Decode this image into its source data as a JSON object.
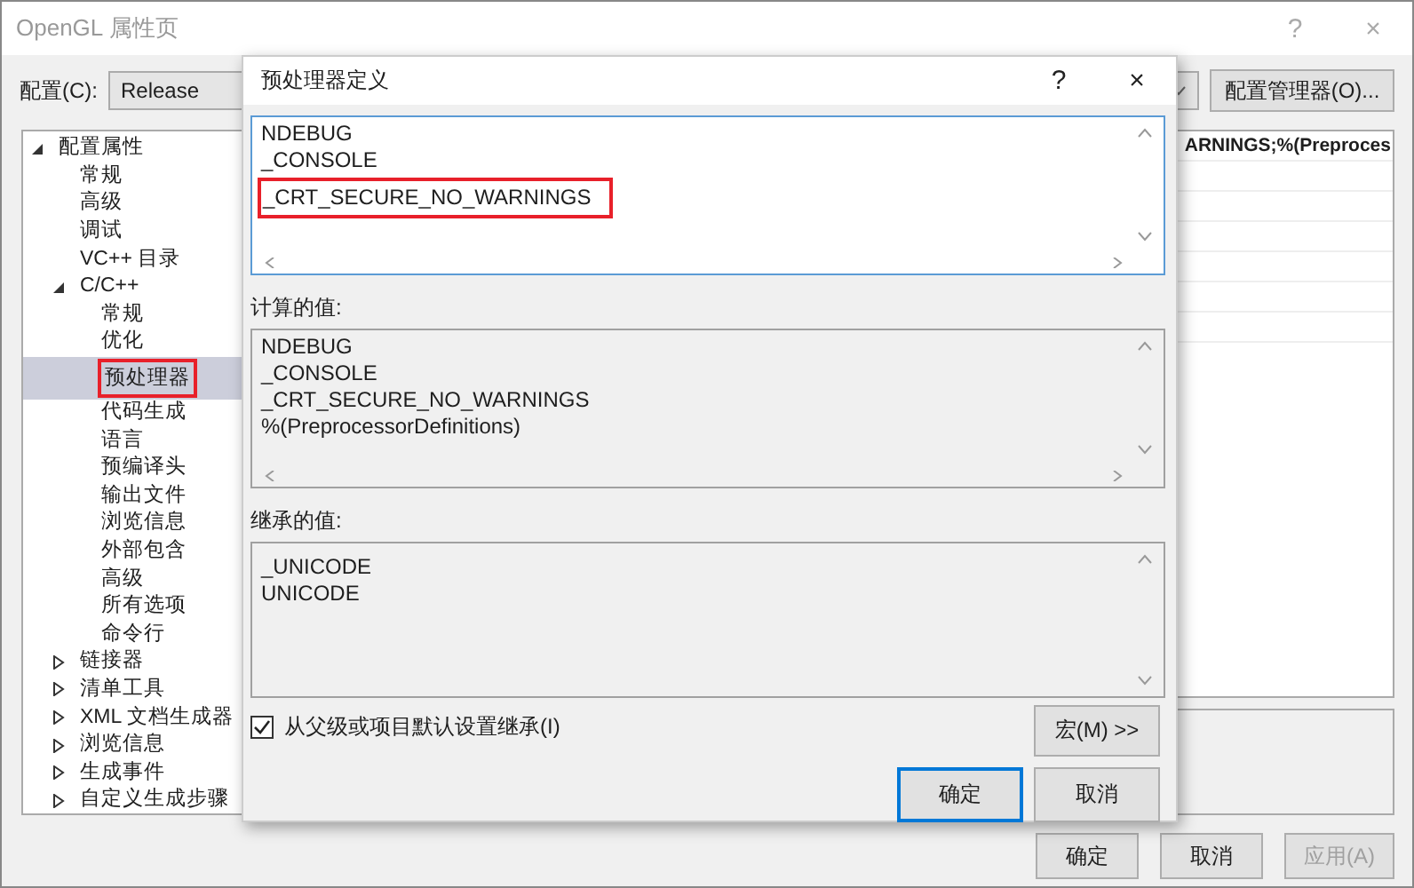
{
  "window": {
    "title": "OpenGL 属性页",
    "help": "?",
    "close": "×"
  },
  "config": {
    "label": "配置(C):",
    "value": "Release",
    "manager_button": "配置管理器(O)..."
  },
  "tree": [
    {
      "label": "配置属性",
      "expanded": true,
      "selected": false,
      "highlighted": false,
      "children": [
        {
          "label": "常规",
          "selected": false,
          "highlighted": false
        },
        {
          "label": "高级",
          "selected": false,
          "highlighted": false
        },
        {
          "label": "调试",
          "selected": false,
          "highlighted": false
        },
        {
          "label": "VC++ 目录",
          "selected": false,
          "highlighted": false
        },
        {
          "label": "C/C++",
          "expanded": true,
          "selected": false,
          "highlighted": false,
          "children": [
            {
              "label": "常规",
              "selected": false,
              "highlighted": false
            },
            {
              "label": "优化",
              "selected": false,
              "highlighted": false
            },
            {
              "label": "预处理器",
              "selected": true,
              "highlighted": true
            },
            {
              "label": "代码生成",
              "selected": false,
              "highlighted": false
            },
            {
              "label": "语言",
              "selected": false,
              "highlighted": false
            },
            {
              "label": "预编译头",
              "selected": false,
              "highlighted": false
            },
            {
              "label": "输出文件",
              "selected": false,
              "highlighted": false
            },
            {
              "label": "浏览信息",
              "selected": false,
              "highlighted": false
            },
            {
              "label": "外部包含",
              "selected": false,
              "highlighted": false
            },
            {
              "label": "高级",
              "selected": false,
              "highlighted": false
            },
            {
              "label": "所有选项",
              "selected": false,
              "highlighted": false
            },
            {
              "label": "命令行",
              "selected": false,
              "highlighted": false
            }
          ]
        },
        {
          "label": "链接器",
          "expanded": false,
          "selected": false,
          "highlighted": false
        },
        {
          "label": "清单工具",
          "expanded": false,
          "selected": false,
          "highlighted": false
        },
        {
          "label": "XML 文档生成器",
          "expanded": false,
          "selected": false,
          "highlighted": false
        },
        {
          "label": "浏览信息",
          "expanded": false,
          "selected": false,
          "highlighted": false
        },
        {
          "label": "生成事件",
          "expanded": false,
          "selected": false,
          "highlighted": false
        },
        {
          "label": "自定义生成步骤",
          "expanded": false,
          "selected": false,
          "highlighted": false
        }
      ]
    }
  ],
  "property_value": "ARNINGS;%(Preproces",
  "buttons": [
    {
      "label": "确定",
      "disabled": false
    },
    {
      "label": "取消",
      "disabled": false
    },
    {
      "label": "应用(A)",
      "disabled": true
    }
  ],
  "dialog": {
    "title": "预处理器定义",
    "help": "?",
    "close": "×",
    "definitions": [
      {
        "text": "NDEBUG",
        "highlighted": false
      },
      {
        "text": "_CONSOLE",
        "highlighted": false
      },
      {
        "text": "_CRT_SECURE_NO_WARNINGS",
        "highlighted": true
      }
    ],
    "computed_label": "计算的值:",
    "computed": [
      "NDEBUG",
      "_CONSOLE",
      "_CRT_SECURE_NO_WARNINGS",
      "%(PreprocessorDefinitions)"
    ],
    "inherited_label": "继承的值:",
    "inherited": [
      "_UNICODE",
      "UNICODE"
    ],
    "inherit_checkbox": {
      "label": "从父级或项目默认设置继承(I)",
      "checked": true
    },
    "macro_button": "宏(M) >>",
    "buttons": [
      {
        "label": "确定",
        "default": true
      },
      {
        "label": "取消",
        "default": false
      }
    ]
  }
}
